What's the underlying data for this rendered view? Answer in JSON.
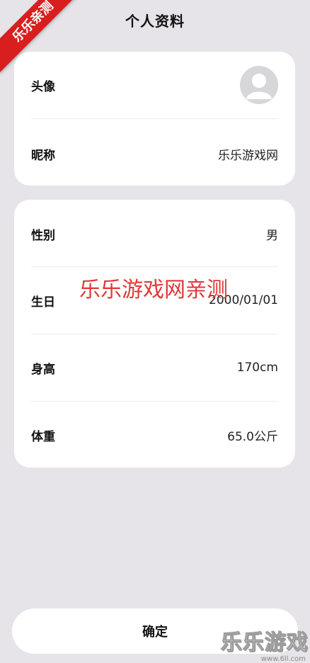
{
  "header": {
    "title": "个人资料"
  },
  "corner_ribbon": "乐乐亲测",
  "profile_card": {
    "avatar_label": "头像",
    "nickname_label": "昵称",
    "nickname_value": "乐乐游戏网"
  },
  "info_card": {
    "gender_label": "性别",
    "gender_value": "男",
    "birthday_label": "生日",
    "birthday_value": "2000/01/01",
    "height_label": "身高",
    "height_value": "170cm",
    "weight_label": "体重",
    "weight_value": "65.0公斤"
  },
  "watermark": "乐乐游戏网亲测",
  "confirm_button": "确定",
  "brand_logo": {
    "text": "乐乐游戏",
    "url": "www.6ll.com"
  },
  "colors": {
    "background": "#e6e4e8",
    "card": "#ffffff",
    "ribbon": "#d81e1e",
    "watermark": "#e23838",
    "avatar": "#d7d7d9"
  },
  "icons": {
    "avatar": "user-placeholder-icon"
  }
}
